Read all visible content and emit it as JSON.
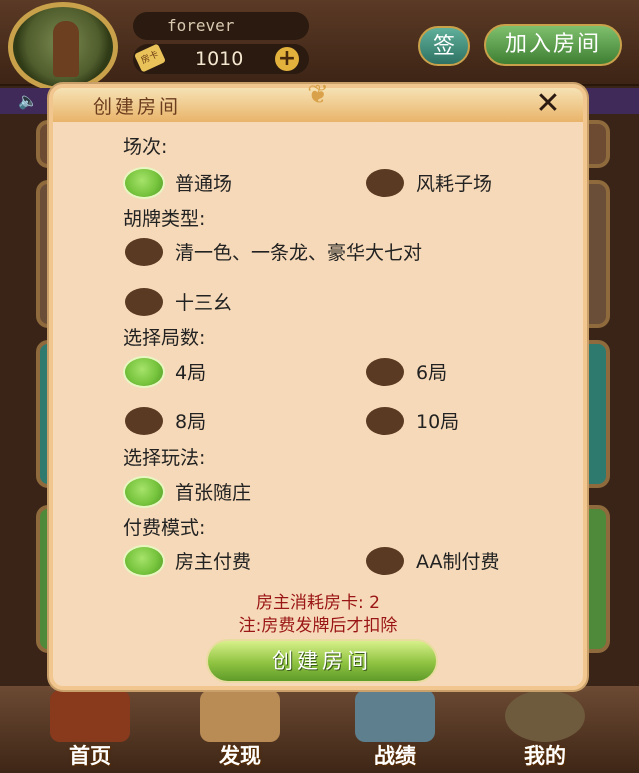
{
  "top": {
    "username": "forever",
    "card_icon_text": "房卡",
    "card_count": "1010",
    "plus_symbol": "+",
    "sign_label": "签",
    "join_room_label": "加入房间"
  },
  "notice": {
    "speaker_icon": "speaker-icon"
  },
  "modal": {
    "title": "创建房间",
    "close_symbol": "✕",
    "sections": {
      "rounds_type": {
        "label": "场次:",
        "options": [
          {
            "label": "普通场",
            "selected": true
          },
          {
            "label": "风耗子场",
            "selected": false
          }
        ]
      },
      "hu_type": {
        "label": "胡牌类型:",
        "options": [
          {
            "label": "清一色、一条龙、豪华大七对",
            "selected": false
          },
          {
            "label": "十三幺",
            "selected": false
          }
        ]
      },
      "game_count": {
        "label": "选择局数:",
        "options": [
          {
            "label": "4局",
            "selected": true
          },
          {
            "label": "6局",
            "selected": false
          },
          {
            "label": "8局",
            "selected": false
          },
          {
            "label": "10局",
            "selected": false
          }
        ]
      },
      "play_rule": {
        "label": "选择玩法:",
        "options": [
          {
            "label": "首张随庄",
            "selected": true
          }
        ]
      },
      "payment": {
        "label": "付费模式:",
        "options": [
          {
            "label": "房主付费",
            "selected": true
          },
          {
            "label": "AA制付费",
            "selected": false
          }
        ]
      }
    },
    "cost_note": "房主消耗房卡: 2",
    "deduct_note": "注:房费发牌后才扣除",
    "create_button": "创建房间"
  },
  "bottom_nav": {
    "items": [
      {
        "label": "首页",
        "icon": "home-icon"
      },
      {
        "label": "发现",
        "icon": "discover-icon"
      },
      {
        "label": "战绩",
        "icon": "record-icon"
      },
      {
        "label": "我的",
        "icon": "profile-icon"
      }
    ]
  }
}
